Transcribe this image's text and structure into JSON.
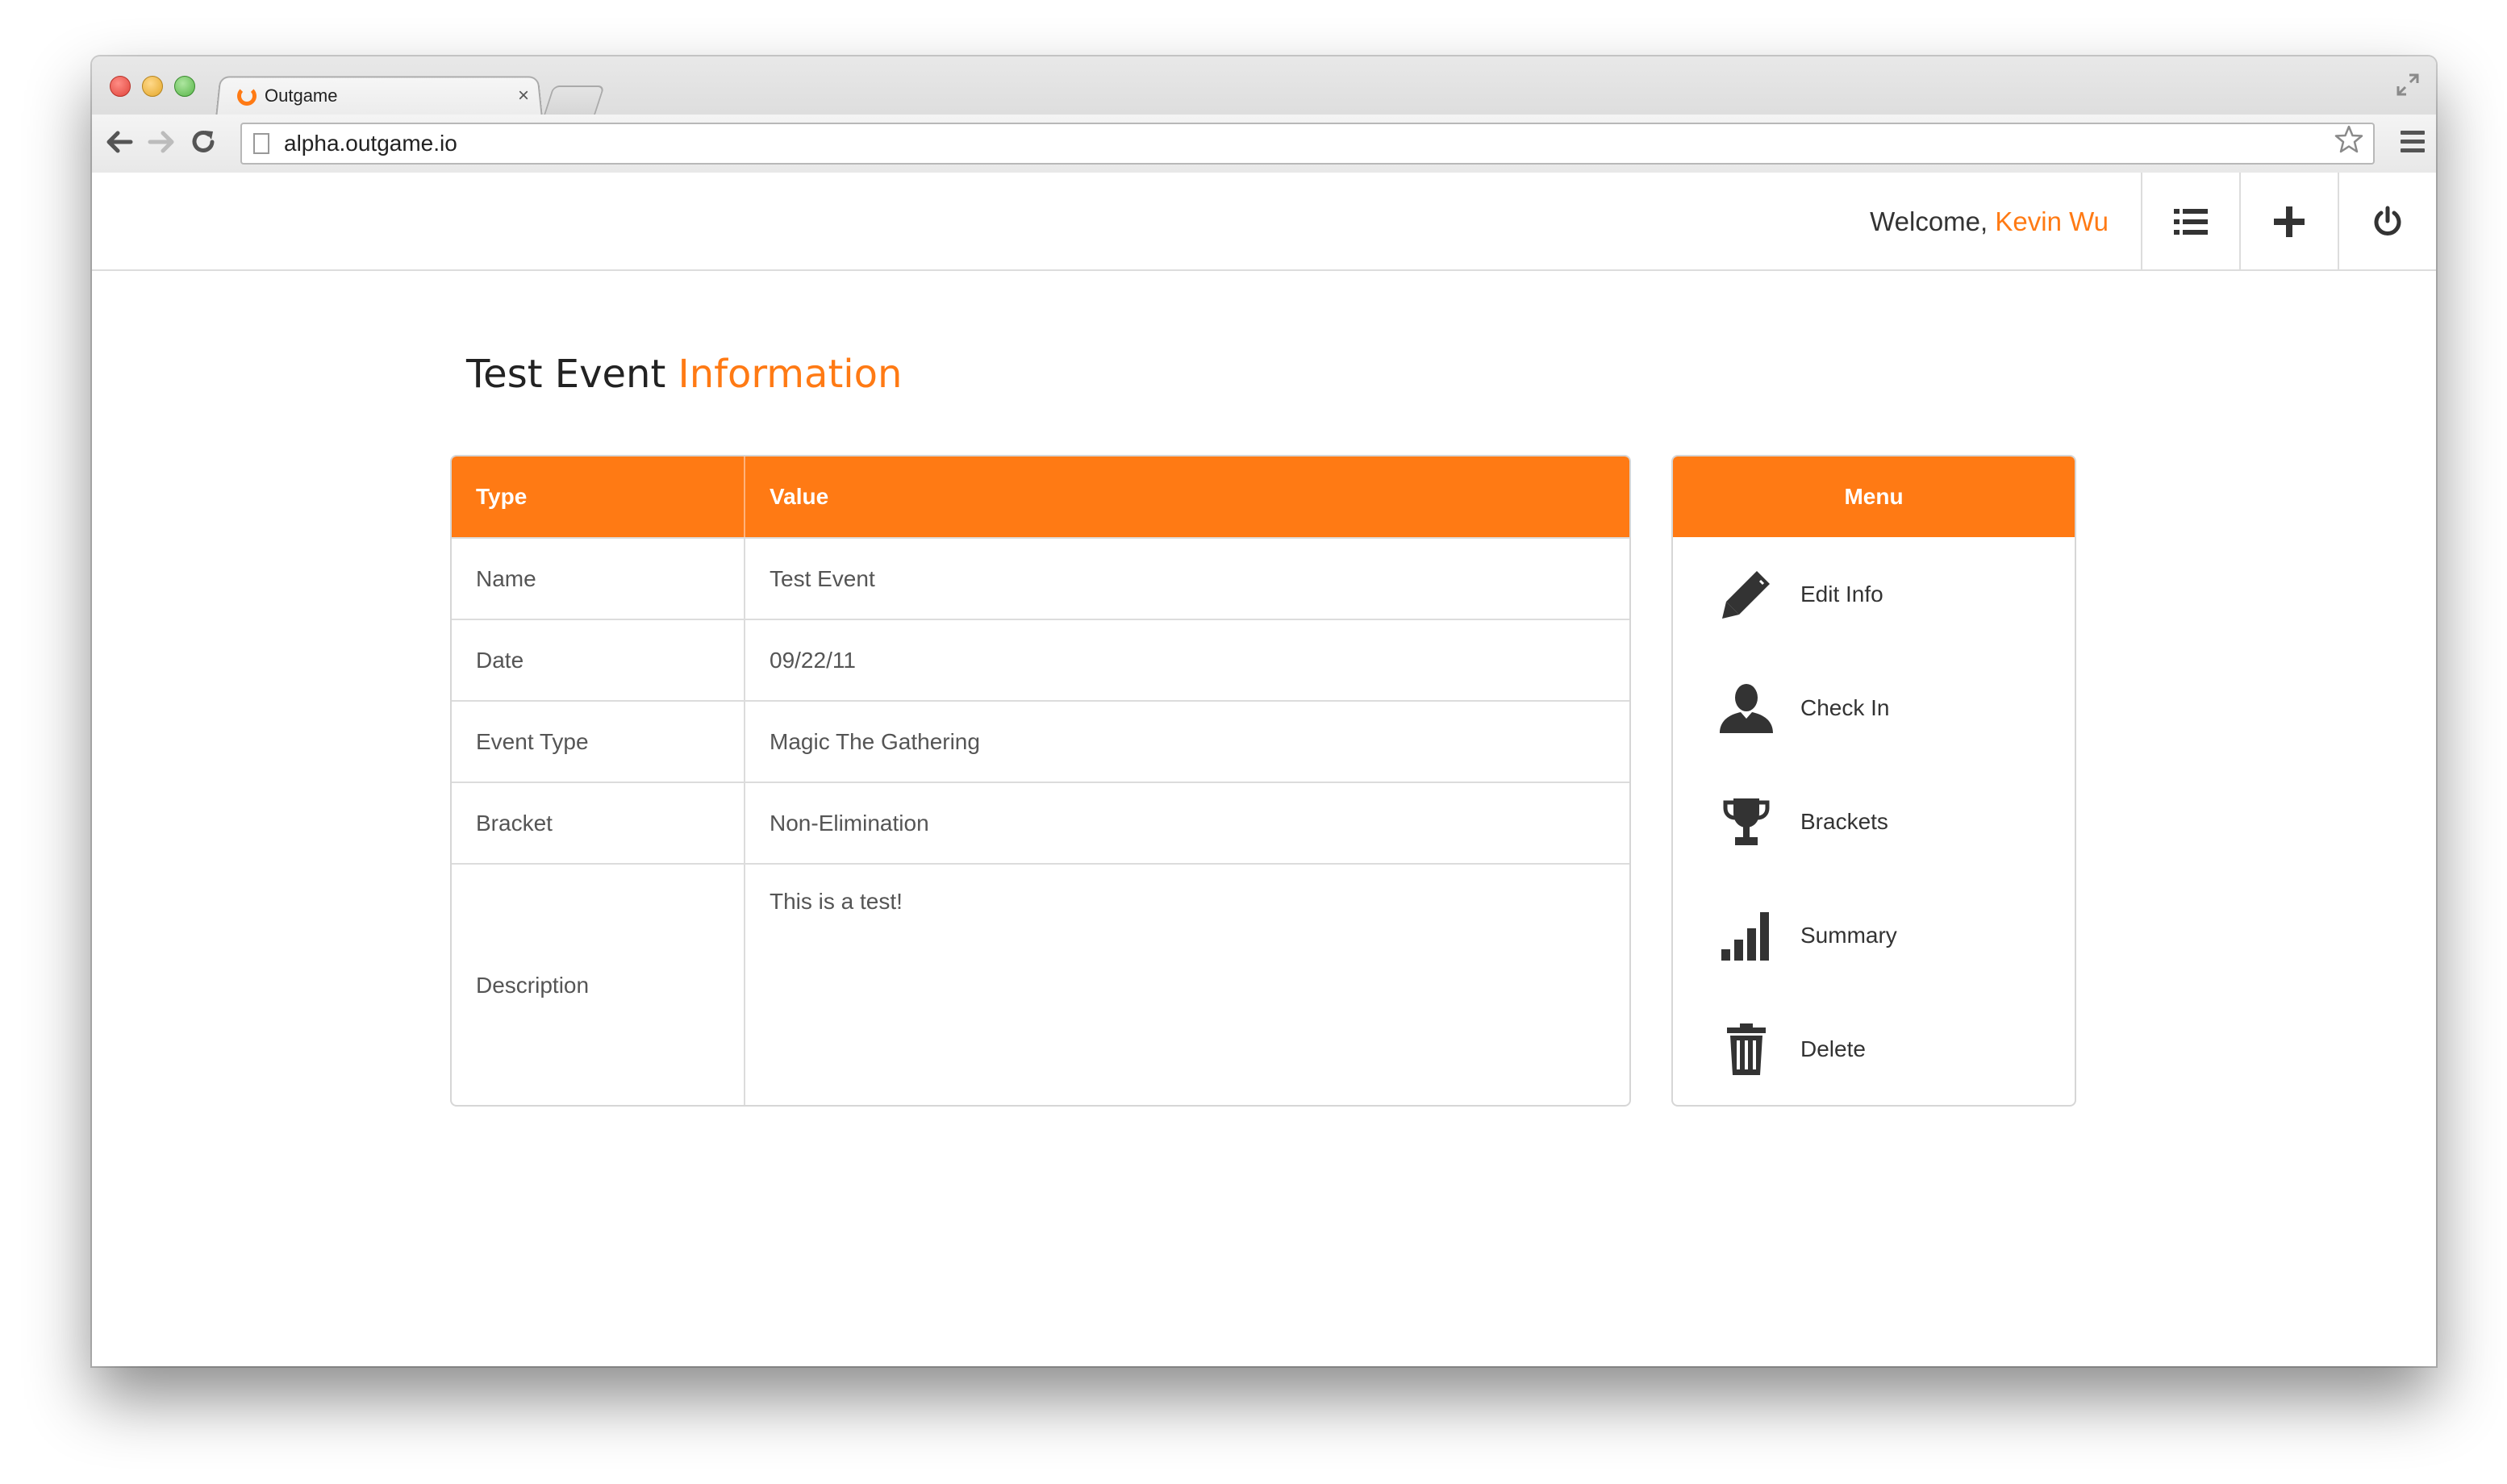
{
  "browser": {
    "tab_title": "Outgame",
    "tab_close": "×",
    "url": "alpha.outgame.io"
  },
  "header": {
    "welcome_prefix": "Welcome, ",
    "user_name": "Kevin Wu"
  },
  "page": {
    "title_main": "Test Event ",
    "title_accent": "Information"
  },
  "info_table": {
    "col_type": "Type",
    "col_value": "Value",
    "rows": [
      {
        "type": "Name",
        "value": "Test Event"
      },
      {
        "type": "Date",
        "value": "09/22/11"
      },
      {
        "type": "Event Type",
        "value": "Magic The Gathering"
      },
      {
        "type": "Bracket",
        "value": "Non-Elimination"
      },
      {
        "type": "Description",
        "value": "This is a test!"
      }
    ]
  },
  "menu": {
    "title": "Menu",
    "items": [
      {
        "label": "Edit Info",
        "icon": "pencil-icon"
      },
      {
        "label": "Check In",
        "icon": "person-icon"
      },
      {
        "label": "Brackets",
        "icon": "trophy-icon"
      },
      {
        "label": "Summary",
        "icon": "bar-chart-icon"
      },
      {
        "label": "Delete",
        "icon": "trash-icon"
      }
    ]
  },
  "colors": {
    "accent": "#ff7a14",
    "text_dark": "#333333",
    "border": "#dcdcdc"
  }
}
